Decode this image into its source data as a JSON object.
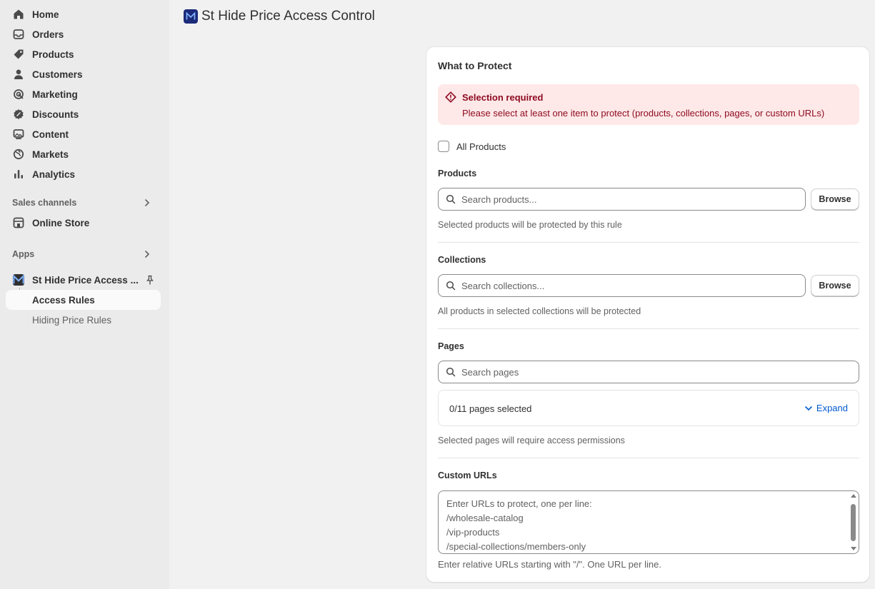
{
  "sidebar": {
    "nav": [
      {
        "label": "Home",
        "icon": "home-icon"
      },
      {
        "label": "Orders",
        "icon": "orders-icon"
      },
      {
        "label": "Products",
        "icon": "tag-icon"
      },
      {
        "label": "Customers",
        "icon": "person-icon"
      },
      {
        "label": "Marketing",
        "icon": "target-icon"
      },
      {
        "label": "Discounts",
        "icon": "discount-icon"
      },
      {
        "label": "Content",
        "icon": "image-icon"
      },
      {
        "label": "Markets",
        "icon": "globe-icon"
      },
      {
        "label": "Analytics",
        "icon": "bar-chart-icon"
      }
    ],
    "sales_channels_label": "Sales channels",
    "online_store_label": "Online Store",
    "apps_label": "Apps",
    "app_name": "St Hide Price Access ...",
    "sub_items": [
      "Access Rules",
      "Hiding Price Rules"
    ]
  },
  "header": {
    "title": "St Hide Price Access Control"
  },
  "card": {
    "title": "What to Protect",
    "banner": {
      "title": "Selection required",
      "text": "Please select at least one item to protect (products, collections, pages, or custom URLs)"
    },
    "all_products_label": "All Products",
    "products": {
      "label": "Products",
      "placeholder": "Search products...",
      "browse": "Browse",
      "help": "Selected products will be protected by this rule"
    },
    "collections": {
      "label": "Collections",
      "placeholder": "Search collections...",
      "browse": "Browse",
      "help": "All products in selected collections will be protected"
    },
    "pages": {
      "label": "Pages",
      "placeholder": "Search pages",
      "count": "0/11 pages selected",
      "expand": "Expand",
      "help": "Selected pages will require access permissions"
    },
    "custom_urls": {
      "label": "Custom URLs",
      "placeholder": "Enter URLs to protect, one per line:\n/wholesale-catalog\n/vip-products\n/special-collections/members-only",
      "help": "Enter relative URLs starting with \"/\". One URL per line."
    }
  },
  "colors": {
    "critical_bg": "#fee9e8",
    "critical_text": "#8e0b21",
    "link": "#005bd3"
  }
}
